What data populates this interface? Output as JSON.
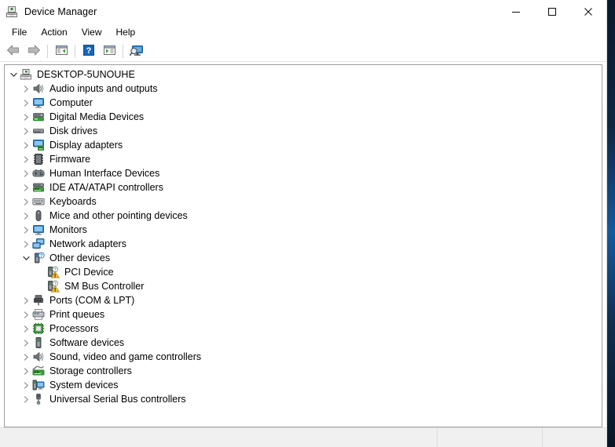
{
  "window": {
    "title": "Device Manager",
    "icon": "device-manager-icon",
    "controls": [
      {
        "name": "minimize-button",
        "glyph": "minimize"
      },
      {
        "name": "maximize-button",
        "glyph": "maximize"
      },
      {
        "name": "close-button",
        "glyph": "close"
      }
    ]
  },
  "menubar": {
    "items": [
      {
        "label": "File"
      },
      {
        "label": "Action"
      },
      {
        "label": "View"
      },
      {
        "label": "Help"
      }
    ]
  },
  "toolbar": {
    "buttons": [
      {
        "name": "back-button",
        "icon": "back-arrow-icon"
      },
      {
        "name": "forward-button",
        "icon": "forward-arrow-icon"
      },
      {
        "name": "separator-1",
        "icon": "separator"
      },
      {
        "name": "show-hide-console-tree-button",
        "icon": "console-tree-icon"
      },
      {
        "name": "separator-2",
        "icon": "separator"
      },
      {
        "name": "help-button",
        "icon": "help-question-icon"
      },
      {
        "name": "properties-button",
        "icon": "properties-icon"
      },
      {
        "name": "separator-3",
        "icon": "separator"
      },
      {
        "name": "scan-for-hardware-changes-button",
        "icon": "scan-monitor-icon"
      }
    ]
  },
  "tree": {
    "root": {
      "label": "DESKTOP-5UNOUHE",
      "icon": "computer-root-icon",
      "expanded": true
    },
    "nodes": [
      {
        "label": "Audio inputs and outputs",
        "icon": "speaker-icon",
        "level": 1,
        "expanded": false,
        "has_children": true
      },
      {
        "label": "Computer",
        "icon": "monitor-icon",
        "level": 1,
        "expanded": false,
        "has_children": true
      },
      {
        "label": "Digital Media Devices",
        "icon": "media-device-icon",
        "level": 1,
        "expanded": false,
        "has_children": true
      },
      {
        "label": "Disk drives",
        "icon": "disk-drive-icon",
        "level": 1,
        "expanded": false,
        "has_children": true
      },
      {
        "label": "Display adapters",
        "icon": "display-adapter-icon",
        "level": 1,
        "expanded": false,
        "has_children": true
      },
      {
        "label": "Firmware",
        "icon": "firmware-chip-icon",
        "level": 1,
        "expanded": false,
        "has_children": true
      },
      {
        "label": "Human Interface Devices",
        "icon": "hid-gamepad-icon",
        "level": 1,
        "expanded": false,
        "has_children": true
      },
      {
        "label": "IDE ATA/ATAPI controllers",
        "icon": "ide-controller-icon",
        "level": 1,
        "expanded": false,
        "has_children": true
      },
      {
        "label": "Keyboards",
        "icon": "keyboard-icon",
        "level": 1,
        "expanded": false,
        "has_children": true
      },
      {
        "label": "Mice and other pointing devices",
        "icon": "mouse-icon",
        "level": 1,
        "expanded": false,
        "has_children": true
      },
      {
        "label": "Monitors",
        "icon": "monitor-icon",
        "level": 1,
        "expanded": false,
        "has_children": true
      },
      {
        "label": "Network adapters",
        "icon": "network-adapter-icon",
        "level": 1,
        "expanded": false,
        "has_children": true
      },
      {
        "label": "Other devices",
        "icon": "unknown-device-icon",
        "level": 1,
        "expanded": true,
        "has_children": true
      },
      {
        "label": "PCI Device",
        "icon": "unknown-device-warning-icon",
        "level": 2,
        "expanded": false,
        "has_children": false,
        "status": "warning"
      },
      {
        "label": "SM Bus Controller",
        "icon": "unknown-device-warning-icon",
        "level": 2,
        "expanded": false,
        "has_children": false,
        "status": "warning"
      },
      {
        "label": "Ports (COM & LPT)",
        "icon": "port-connector-icon",
        "level": 1,
        "expanded": false,
        "has_children": true
      },
      {
        "label": "Print queues",
        "icon": "printer-icon",
        "level": 1,
        "expanded": false,
        "has_children": true
      },
      {
        "label": "Processors",
        "icon": "processor-chip-icon",
        "level": 1,
        "expanded": false,
        "has_children": true
      },
      {
        "label": "Software devices",
        "icon": "software-device-icon",
        "level": 1,
        "expanded": false,
        "has_children": true
      },
      {
        "label": "Sound, video and game controllers",
        "icon": "speaker-icon",
        "level": 1,
        "expanded": false,
        "has_children": true
      },
      {
        "label": "Storage controllers",
        "icon": "storage-controller-icon",
        "level": 1,
        "expanded": false,
        "has_children": true
      },
      {
        "label": "System devices",
        "icon": "system-device-icon",
        "level": 1,
        "expanded": false,
        "has_children": true
      },
      {
        "label": "Universal Serial Bus controllers",
        "icon": "usb-controller-icon",
        "level": 1,
        "expanded": false,
        "has_children": true
      }
    ]
  },
  "statusbar": {
    "panes": [
      {
        "text": ""
      },
      {
        "text": ""
      },
      {
        "text": ""
      }
    ]
  },
  "colors": {
    "window_bg": "#ffffff",
    "statusbar_bg": "#f0f0f0",
    "tree_border": "#a0a0a0",
    "warning_yellow": "#f5c131",
    "accent_blue": "#1e90d2",
    "desktop_navy": "#0d2744"
  }
}
